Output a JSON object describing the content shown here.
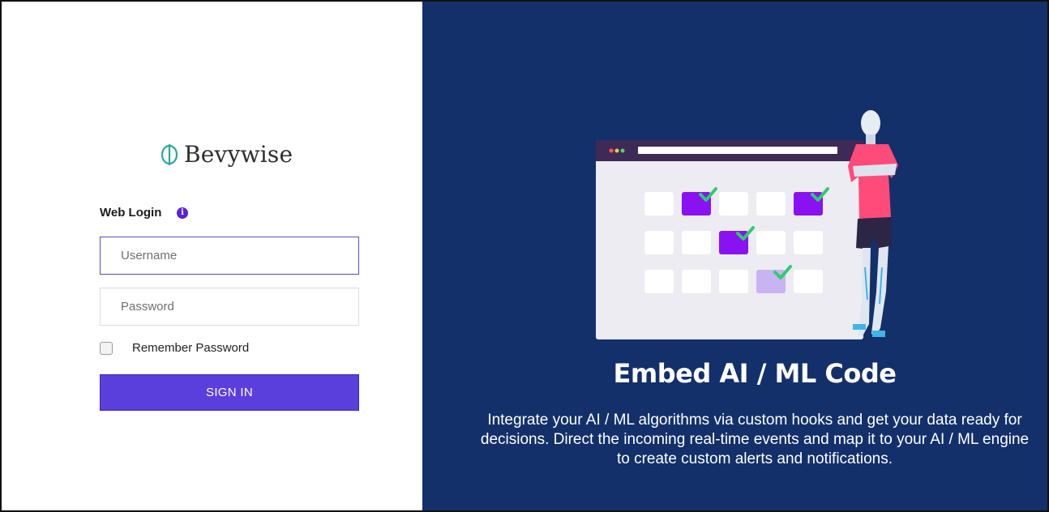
{
  "brand": {
    "name": "Bevywise"
  },
  "login": {
    "title": "Web Login",
    "username_placeholder": "Username",
    "password_placeholder": "Password",
    "remember_label": "Remember Password",
    "signin_label": "SIGN IN"
  },
  "promo": {
    "title": "Embed AI / ML Code",
    "description": "Integrate your AI / ML algorithms via custom hooks and get your data ready for decisions. Direct the incoming real-time events and map it to your AI / ML engine to create custom alerts and notifications."
  },
  "colors": {
    "accent": "#5b3fdc",
    "panel_bg": "#13306b",
    "check": "#2ecc71"
  }
}
